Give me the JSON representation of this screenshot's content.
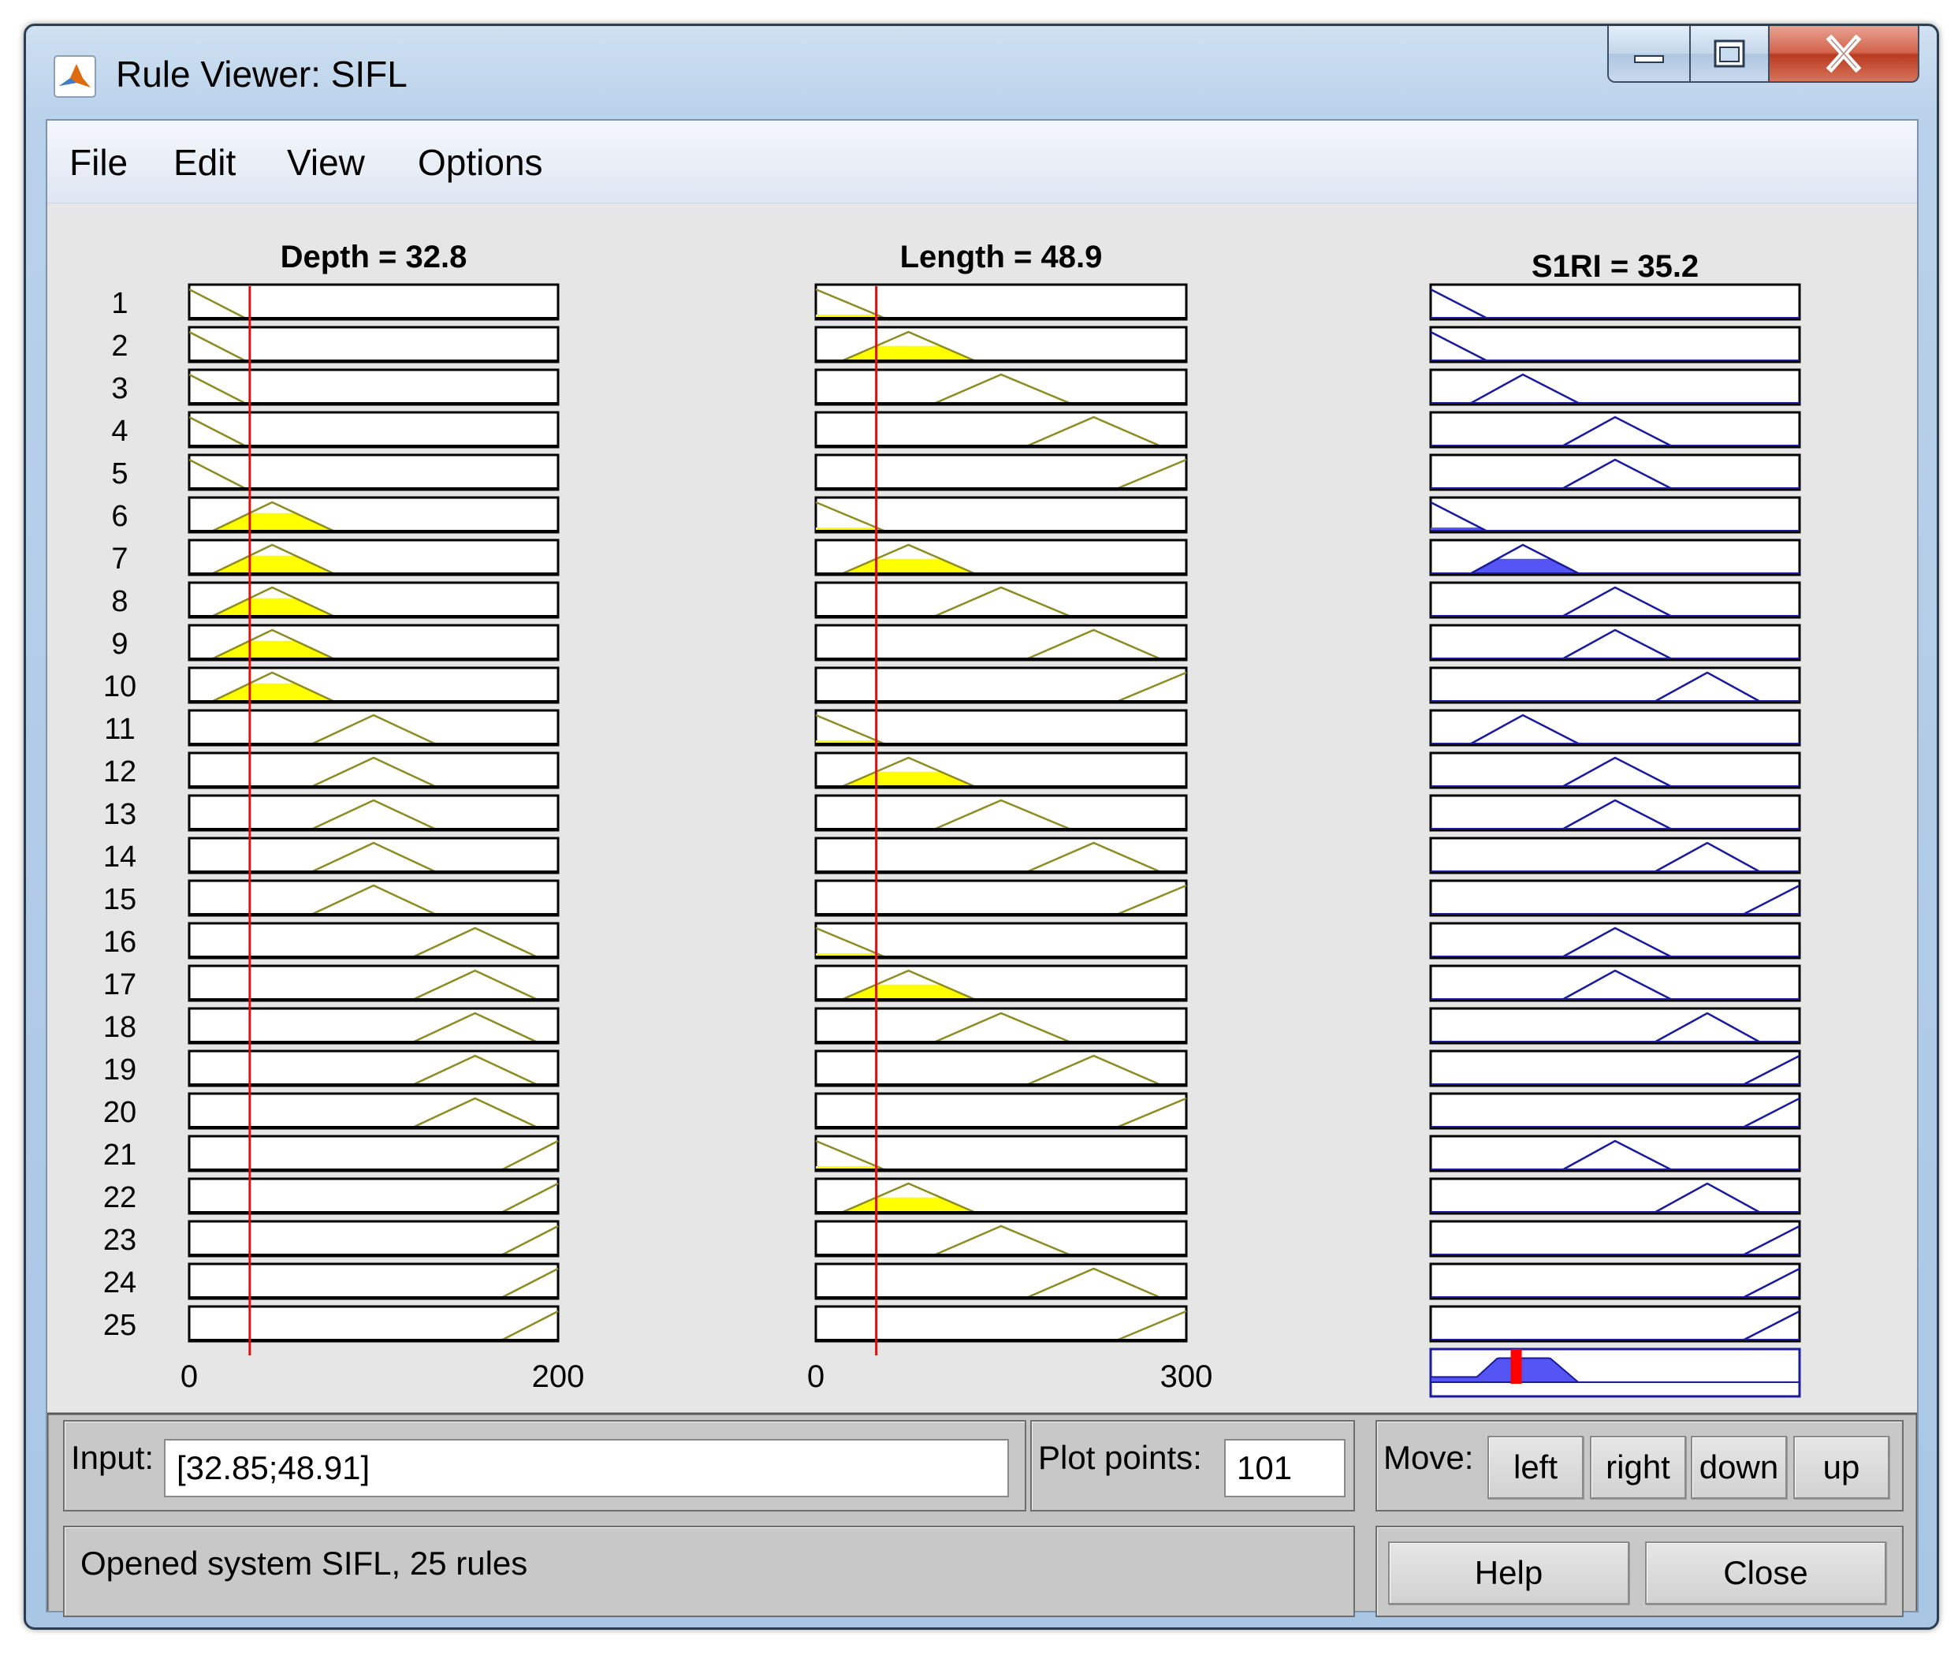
{
  "window": {
    "title": "Rule Viewer: SIFL"
  },
  "menu": [
    "File",
    "Edit",
    "View",
    "Options"
  ],
  "colors": {
    "input_fill": "#ffff00",
    "input_line": "#8c8c23",
    "output_line": "#1a1a9c",
    "output_fill": "#5555f5",
    "input_marker": "#e01010",
    "output_marker": "#ff0000",
    "panel_bg": "#e6e6e6"
  },
  "columns": [
    {
      "type": "input",
      "title": "Depth = 32.8",
      "range": [
        0,
        200
      ],
      "value": 32.85,
      "tick_min": "0",
      "tick_max": "200",
      "mfs": [
        {
          "kind": "zmf",
          "params": [
            0,
            30
          ]
        },
        {
          "kind": "trimf",
          "params": [
            13,
            45,
            78
          ]
        },
        {
          "kind": "trimf",
          "params": [
            67,
            100,
            133
          ]
        },
        {
          "kind": "trimf",
          "params": [
            122,
            155,
            188
          ]
        },
        {
          "kind": "smf",
          "params": [
            170,
            200
          ]
        }
      ]
    },
    {
      "type": "input",
      "title": "Length = 48.9",
      "range": [
        0,
        300
      ],
      "value": 48.91,
      "tick_min": "0",
      "tick_max": "300",
      "mfs": [
        {
          "kind": "zmf",
          "params": [
            0,
            55
          ]
        },
        {
          "kind": "trimf",
          "params": [
            22,
            75,
            128
          ]
        },
        {
          "kind": "trimf",
          "params": [
            97,
            150,
            205
          ]
        },
        {
          "kind": "trimf",
          "params": [
            172,
            225,
            278
          ]
        },
        {
          "kind": "smf",
          "params": [
            245,
            300
          ]
        }
      ]
    },
    {
      "type": "output",
      "title": "S1RI = 35.2",
      "range": [
        0,
        100
      ],
      "value": 23.2,
      "mfs": [
        {
          "kind": "zmf",
          "params": [
            0,
            15
          ]
        },
        {
          "kind": "trimf",
          "params": [
            11,
            25,
            40
          ]
        },
        {
          "kind": "trimf",
          "params": [
            36,
            50,
            65
          ]
        },
        {
          "kind": "trimf",
          "params": [
            61,
            75,
            89
          ]
        },
        {
          "kind": "smf",
          "params": [
            85,
            100
          ]
        }
      ]
    }
  ],
  "rules": [
    {
      "n": "1",
      "in1": 0,
      "in2": 0,
      "out": 0
    },
    {
      "n": "2",
      "in1": 0,
      "in2": 1,
      "out": 0
    },
    {
      "n": "3",
      "in1": 0,
      "in2": 2,
      "out": 1
    },
    {
      "n": "4",
      "in1": 0,
      "in2": 3,
      "out": 2
    },
    {
      "n": "5",
      "in1": 0,
      "in2": 4,
      "out": 2
    },
    {
      "n": "6",
      "in1": 1,
      "in2": 0,
      "out": 0
    },
    {
      "n": "7",
      "in1": 1,
      "in2": 1,
      "out": 1
    },
    {
      "n": "8",
      "in1": 1,
      "in2": 2,
      "out": 2
    },
    {
      "n": "9",
      "in1": 1,
      "in2": 3,
      "out": 2
    },
    {
      "n": "10",
      "in1": 1,
      "in2": 4,
      "out": 3
    },
    {
      "n": "11",
      "in1": 2,
      "in2": 0,
      "out": 1
    },
    {
      "n": "12",
      "in1": 2,
      "in2": 1,
      "out": 2
    },
    {
      "n": "13",
      "in1": 2,
      "in2": 2,
      "out": 2
    },
    {
      "n": "14",
      "in1": 2,
      "in2": 3,
      "out": 3
    },
    {
      "n": "15",
      "in1": 2,
      "in2": 4,
      "out": 4
    },
    {
      "n": "16",
      "in1": 3,
      "in2": 0,
      "out": 2
    },
    {
      "n": "17",
      "in1": 3,
      "in2": 1,
      "out": 2
    },
    {
      "n": "18",
      "in1": 3,
      "in2": 2,
      "out": 3
    },
    {
      "n": "19",
      "in1": 3,
      "in2": 3,
      "out": 4
    },
    {
      "n": "20",
      "in1": 3,
      "in2": 4,
      "out": 4
    },
    {
      "n": "21",
      "in1": 4,
      "in2": 0,
      "out": 2
    },
    {
      "n": "22",
      "in1": 4,
      "in2": 1,
      "out": 3
    },
    {
      "n": "23",
      "in1": 4,
      "in2": 2,
      "out": 4
    },
    {
      "n": "24",
      "in1": 4,
      "in2": 3,
      "out": 4
    },
    {
      "n": "25",
      "in1": 4,
      "in2": 4,
      "out": 4
    }
  ],
  "controls": {
    "input_label": "Input:",
    "input_value": "[32.85;48.91]",
    "plot_points_label": "Plot points:",
    "plot_points_value": "101",
    "move_label": "Move:",
    "move_left": "left",
    "move_right": "right",
    "move_down": "down",
    "move_up": "up",
    "status": "Opened system SIFL, 25 rules",
    "help": "Help",
    "close": "Close"
  }
}
